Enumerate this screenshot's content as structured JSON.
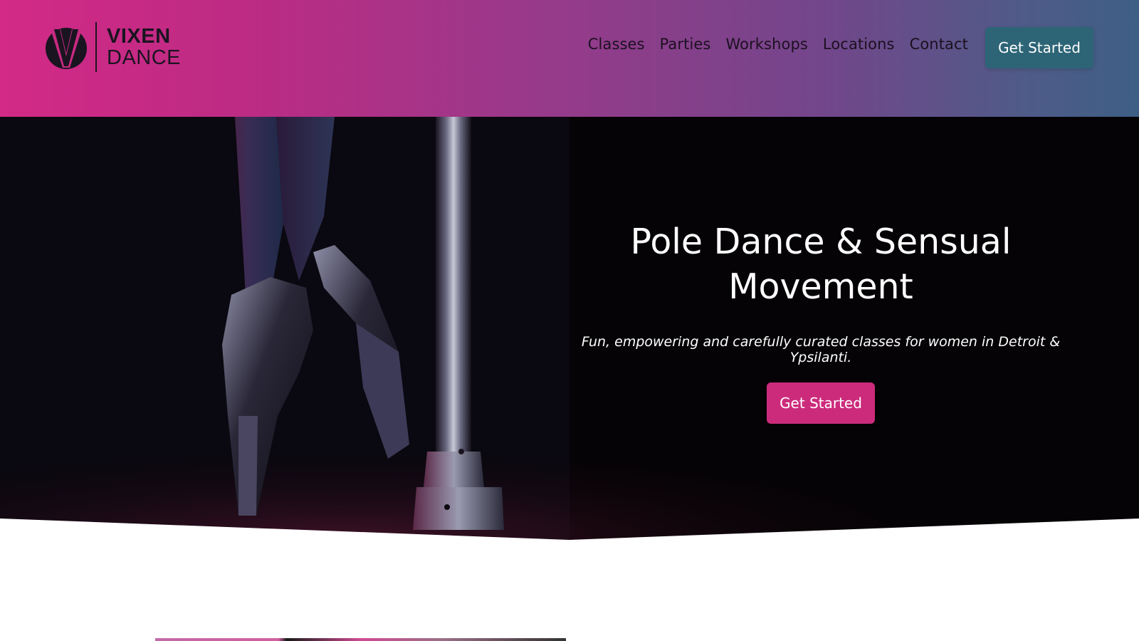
{
  "brand": {
    "name_line1": "VIXEN",
    "name_line2": "DANCE",
    "icon": "vixen-v-logo-icon"
  },
  "nav": {
    "items": [
      {
        "label": "Classes"
      },
      {
        "label": "Parties"
      },
      {
        "label": "Workshops"
      },
      {
        "label": "Locations"
      },
      {
        "label": "Contact"
      }
    ],
    "cta_label": "Get Started"
  },
  "hero": {
    "title": "Pole Dance & Sensual Movement",
    "subtitle": "Fun, empowering and carefully curated classes for women in Detroit & Ypsilanti.",
    "cta_label": "Get Started",
    "image": "pole-dancer-heels-photo"
  },
  "colors": {
    "header_gradient_start": "#d22a86",
    "header_gradient_end": "#3e5f85",
    "header_cta": "#2d6577",
    "hero_cta": "#cc2b7c",
    "hero_background": "#050204"
  }
}
